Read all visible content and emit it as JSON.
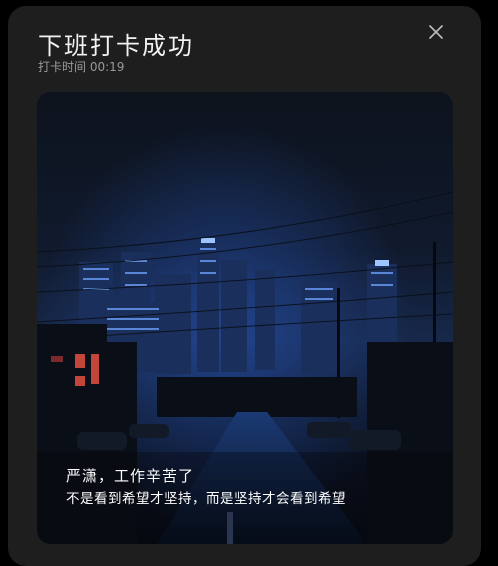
{
  "dialog": {
    "title": "下班打卡成功",
    "clock_label": "打卡时间 00:19",
    "close_icon": "close-icon"
  },
  "card": {
    "image": "night-city-skyline-photo",
    "greeting": "严潇，工作辛苦了",
    "quote": "不是看到希望才坚持，而是坚持才会看到希望"
  },
  "colors": {
    "modal_bg": "#1e1e1e",
    "page_bg": "#000000",
    "title_text": "#f2f2f2",
    "subtitle_text": "#9a9a9a"
  }
}
